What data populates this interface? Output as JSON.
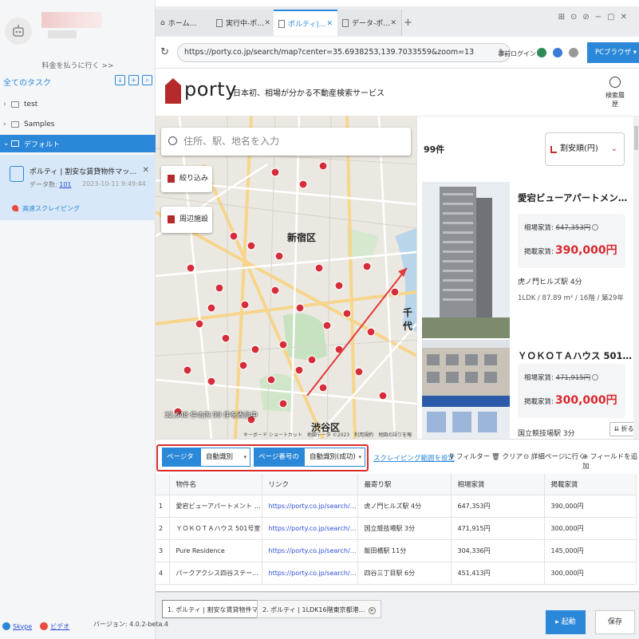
{
  "sidebar": {
    "upgrade_link": "料金を払うに行く >>",
    "all_tasks": "全てのタスク",
    "folders": [
      {
        "label": "test"
      },
      {
        "label": "Samples"
      },
      {
        "label": "デフォルト"
      }
    ],
    "task": {
      "title": "ポルティ | 割安な賃貸物件マップ-スクレイ…",
      "count_label": "データ数:",
      "count": "101",
      "date": "2023-10-11 9:49:44",
      "mode": "高速スクレイピング"
    },
    "footer": {
      "skype": "Skype",
      "video": "ビデオ",
      "version": "バージョン: 4.0.2-beta.4"
    }
  },
  "browser": {
    "tabs": [
      {
        "label": "ホーム…"
      },
      {
        "label": "実行中-ポ…"
      },
      {
        "label": "ポルティ|…"
      },
      {
        "label": "データ-ポ…"
      }
    ],
    "url": "https://porty.co.jp/search/map?center=35.6938253,139.7033559&zoom=13",
    "prelogin": "事前ログイン",
    "pc_browser": "PCブラウザ"
  },
  "porty": {
    "logo": "porty",
    "tagline": "日本初、相場が分かる不動産検索サービス",
    "history": "検索履歴",
    "search_placeholder": "住所、駅、地名を入力",
    "filter": "絞り込み",
    "nearby": "周辺施設",
    "map_labels": {
      "shinjuku": "新宿区",
      "shibuya": "渋谷区",
      "chiyoda": "千代"
    },
    "map_count": "32,648 件の内 99 件を表示中",
    "map_attr": "キーボード ショートカット　地図データ ©2023　利用規約　地図の誤りを報告する",
    "result_count": "99件",
    "sort": "割安順(円)",
    "listings": [
      {
        "title": "愛宕ビューアパートメン…",
        "rent_label": "相場家賃:",
        "rent": "647,353円",
        "price_label": "掲載家賃:",
        "price": "390,000円",
        "station": "虎ノ門ヒルズ駅 4分",
        "spec": "1LDK / 87.89 m² / 16階 / 築29年"
      },
      {
        "title": "ＹＯＫＯＴＡハウス 501…",
        "rent_label": "相場家賃:",
        "rent": "471,915円",
        "price_label": "掲載家賃:",
        "price": "300,000円",
        "station": "国立競技場駅 3分",
        "spec": ""
      }
    ],
    "fold": "折る"
  },
  "toolbar": {
    "page_type_label": "ページタイプ",
    "page_type_value": "自動識別",
    "page_num_label": "ページ番号の設定",
    "page_num_value": "自動識別(成功)",
    "range_link": "スクレイピング範囲を設定",
    "filter": "フィルター",
    "clear": "クリア",
    "detail": "詳細ページに行く",
    "add_field": "フィールドを追加"
  },
  "table": {
    "headers": [
      "",
      "物件名",
      "リンク",
      "最寄り駅",
      "相場家賃",
      "掲載家賃"
    ],
    "rows": [
      [
        "1",
        "愛宕ビューアパートメント 1606…",
        "https://porty.co.jp/search/chintai/14…",
        "虎ノ門ヒルズ駅 4分",
        "647,353円",
        "390,000円"
      ],
      [
        "2",
        "ＹＯＫＯＴＡハウス 501号室",
        "https://porty.co.jp/search/chintai/14…",
        "国立競技場駅 3分",
        "471,915円",
        "300,000円"
      ],
      [
        "3",
        "Pure Residence",
        "https://porty.co.jp/search/chintai/14…",
        "飯田橋駅 11分",
        "304,336円",
        "145,000円"
      ],
      [
        "4",
        "パークアクシス四谷ステージ 130…",
        "https://porty.co.jp/search/chintai/14…",
        "四谷三丁目駅 6分",
        "451,413円",
        "300,000円"
      ]
    ]
  },
  "bottom": {
    "tabs": [
      "1. ポルティ | 割安な賃貸物件マップ",
      "2. ポルティ | 1LDK16階東京都港…"
    ],
    "start": "起動",
    "save": "保存"
  },
  "colors": {
    "accent": "#2b88d8",
    "porty_red": "#b52a2a",
    "price_red": "#d8272d",
    "highlight": "#d92b2b"
  }
}
